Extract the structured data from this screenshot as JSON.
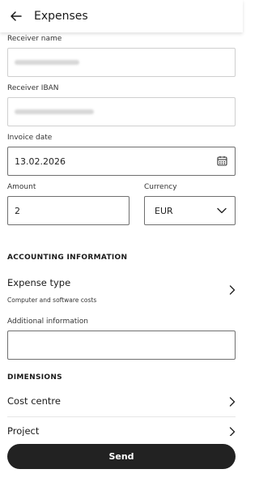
{
  "header": {
    "title": "Expenses",
    "back_icon": "arrow-left-icon"
  },
  "form": {
    "receiver_name_label": "Receiver name",
    "receiver_iban_label": "Receiver IBAN",
    "invoice_date_label": "Invoice date",
    "invoice_date_value": "13.02.2026",
    "amount_label": "Amount",
    "amount_value": "2",
    "currency_label": "Currency",
    "currency_value": "EUR"
  },
  "accounting": {
    "section_title": "ACCOUNTING INFORMATION",
    "expense_type_label": "Expense type",
    "expense_type_value": "Computer and software costs",
    "additional_info_label": "Additional information"
  },
  "dimensions": {
    "section_title": "DIMENSIONS",
    "cost_centre_label": "Cost centre",
    "project_label": "Project"
  },
  "actions": {
    "send_label": "Send"
  },
  "colors": {
    "button_bg": "#222222",
    "border": "#cfcfcf",
    "border_dark": "#6f6f6f"
  }
}
